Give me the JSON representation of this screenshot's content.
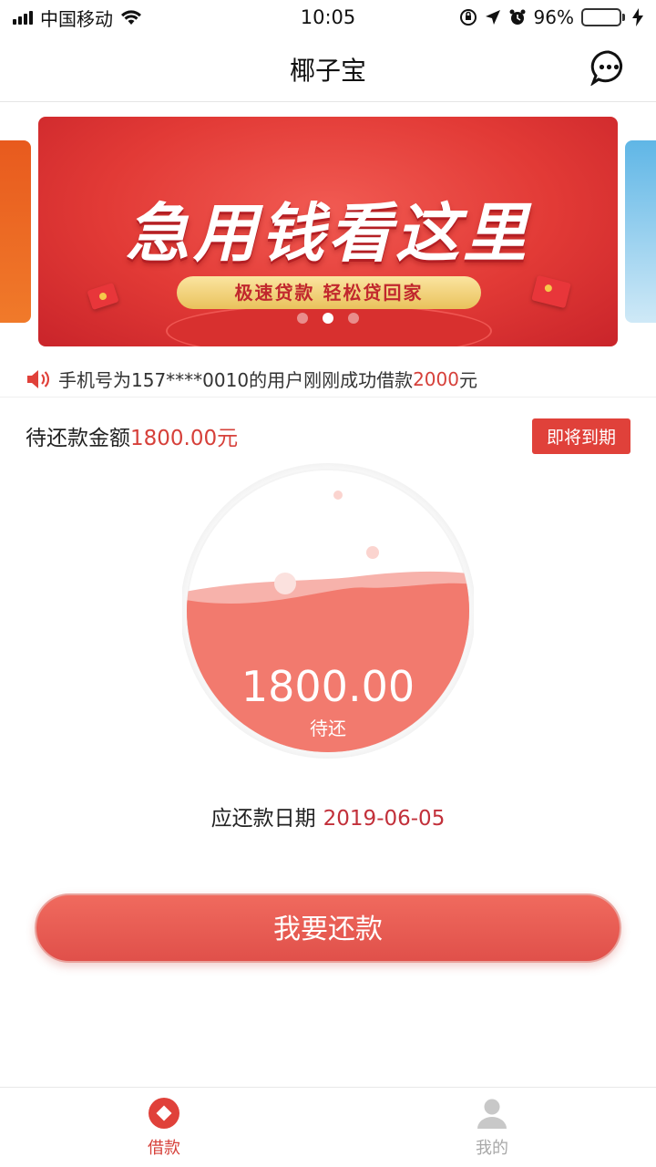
{
  "status_bar": {
    "carrier": "中国移动",
    "time": "10:05",
    "battery": "96%",
    "battery_level": 0.96
  },
  "nav": {
    "title": "椰子宝"
  },
  "banner": {
    "headline": "急用钱看这里",
    "pill_text": "极速贷款  轻松贷回家",
    "active_dot": 1,
    "dot_count": 3
  },
  "marquee": {
    "prefix": "手机号为157****0010的用户刚刚成功借款",
    "amount": "2000",
    "suffix": "元"
  },
  "repayment": {
    "label": "待还款金额",
    "amount": "1800.00元",
    "badge": "即将到期",
    "gauge_amount": "1800.00",
    "gauge_label": "待还",
    "gauge_fill": 0.55,
    "due_label": "应还款日期",
    "due_date": "2019-06-05",
    "button": "我要还款"
  },
  "tabs": [
    {
      "label": "借款",
      "active": true
    },
    {
      "label": "我的",
      "active": false
    }
  ],
  "colors": {
    "accent": "#e0504a",
    "accent_text": "#d6403a",
    "inactive": "#a8a8a8"
  }
}
